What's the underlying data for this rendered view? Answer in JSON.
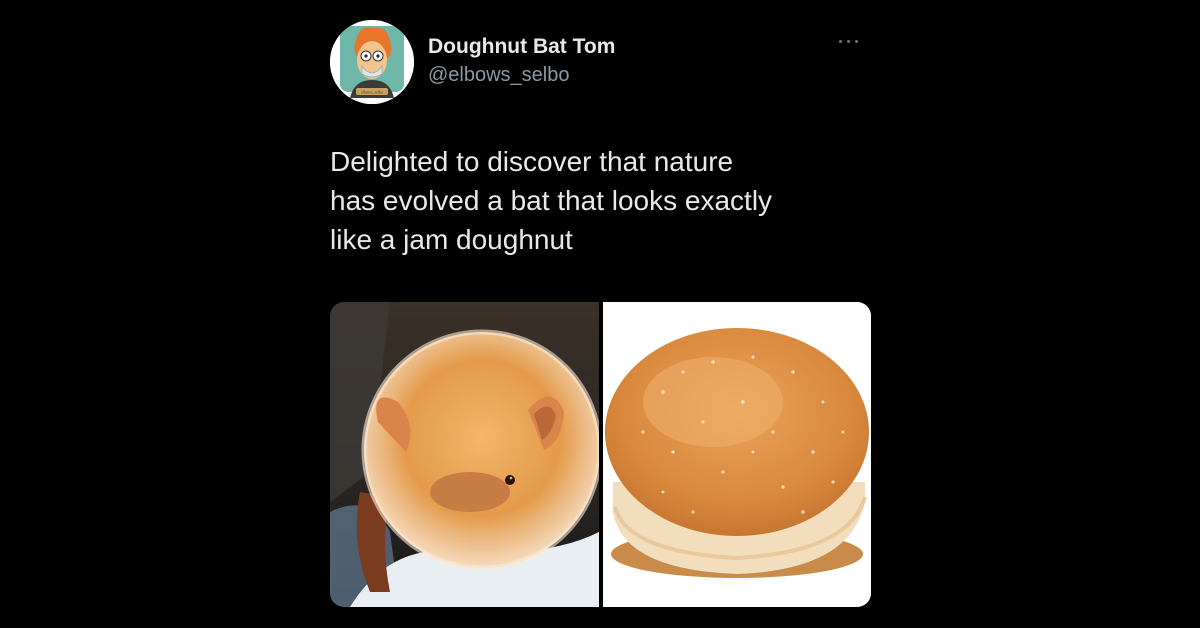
{
  "author": {
    "display_name": "Doughnut Bat Tom",
    "handle": "@elbows_selbo",
    "avatar_icon": "cartoon-avatar-icon",
    "avatar_caption": "elbows_selbo"
  },
  "tweet": {
    "text": "Delighted to discover that nature\nhas evolved a bat that looks exactly\nlike a jam doughnut"
  },
  "media": {
    "images": [
      {
        "subject": "bat-photo"
      },
      {
        "subject": "jam-doughnut-photo"
      }
    ]
  },
  "colors": {
    "background": "#000000",
    "text_primary": "#e7e9ea",
    "text_secondary": "#8b98a5"
  },
  "icons": {
    "more": "more-options-icon"
  }
}
